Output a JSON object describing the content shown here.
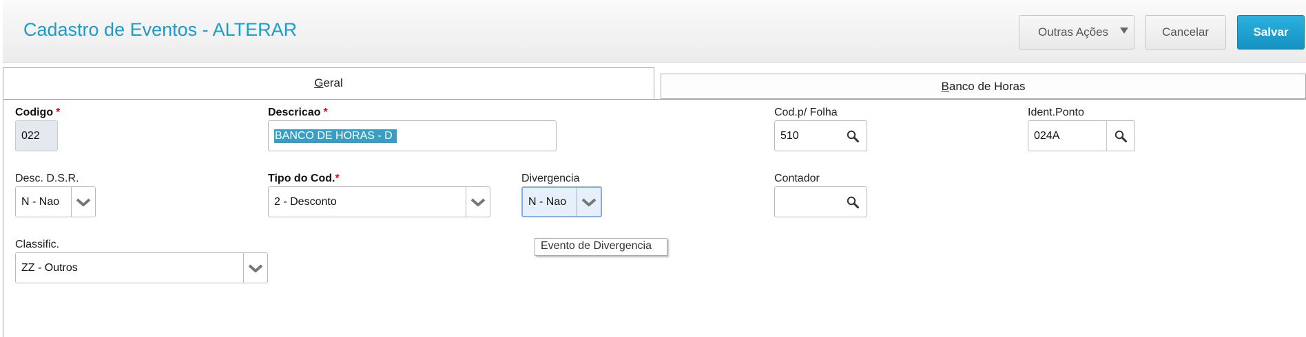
{
  "header": {
    "title": "Cadastro de Eventos - ALTERAR",
    "buttons": {
      "outras_acoes": "Outras Ações",
      "cancelar": "Cancelar",
      "salvar": "Salvar"
    }
  },
  "tabs": {
    "geral": {
      "accel": "G",
      "rest": "eral"
    },
    "banco": {
      "accel": "B",
      "rest": "anco de Horas"
    }
  },
  "form": {
    "codigo": {
      "label": "Codigo",
      "required": "*",
      "value": "022"
    },
    "descricao": {
      "label": "Descricao",
      "required": "*",
      "value": "BANCO DE HORAS - D"
    },
    "cod_folha": {
      "label": "Cod.p/ Folha",
      "value": "510"
    },
    "ident_ponto": {
      "label": "Ident.Ponto",
      "value": "024A"
    },
    "desc_dsr": {
      "label": "Desc. D.S.R.",
      "value": "N - Nao"
    },
    "tipo_cod": {
      "label": "Tipo do Cod.",
      "required": "*",
      "value": "2 - Desconto"
    },
    "divergencia": {
      "label": "Divergencia",
      "value": "N - Nao"
    },
    "contador": {
      "label": "Contador",
      "value": ""
    },
    "classific": {
      "label": "Classific.",
      "value": "ZZ - Outros"
    }
  },
  "tooltip": {
    "text": "Evento de Divergencia"
  },
  "icons": {
    "lookup": "magnifier-icon",
    "dropdown": "chevron-down-icon",
    "menu_caret": "caret-down-icon"
  },
  "colors": {
    "accent": "#1d9cc9",
    "primary_button": "#1a9fd0",
    "required": "#e00000",
    "selection": "#3a9ec3"
  }
}
